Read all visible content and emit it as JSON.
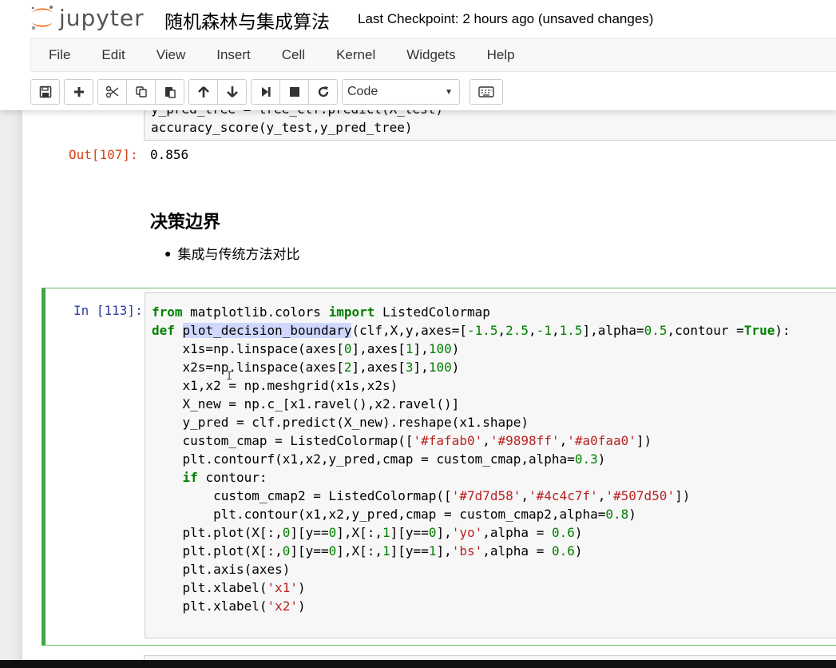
{
  "header": {
    "logo_text": "jupyter",
    "notebook_title": "随机森林与集成算法",
    "checkpoint": "Last Checkpoint: 2 hours ago (unsaved changes)"
  },
  "menu": [
    "File",
    "Edit",
    "View",
    "Insert",
    "Cell",
    "Kernel",
    "Widgets",
    "Help"
  ],
  "toolbar": {
    "cell_type": "Code",
    "icons": [
      "save-icon",
      "plus-icon",
      "cut-icon",
      "copy-icon",
      "paste-icon",
      "arrow-up-icon",
      "arrow-down-icon",
      "step-forward-icon",
      "stop-icon",
      "restart-icon",
      "keyboard-icon"
    ]
  },
  "cells": {
    "previous_input": {
      "line1": "y_pred_tree = tree_clf.predict(X_test)",
      "line2": "accuracy_score(y_test,y_pred_tree)"
    },
    "previous_output": {
      "prompt": "Out[107]:",
      "value": "0.856"
    },
    "markdown": {
      "heading": "决策边界",
      "bullet": "集成与传统方法对比"
    },
    "current": {
      "prompt": "In [113]:",
      "lines": [
        {
          "segments": [
            {
              "t": "from",
              "c": "kw"
            },
            {
              "t": " matplotlib.colors "
            },
            {
              "t": "import",
              "c": "kw"
            },
            {
              "t": " ListedColormap"
            }
          ]
        },
        {
          "segments": [
            {
              "t": "def",
              "c": "kw"
            },
            {
              "t": " "
            },
            {
              "t": "plot_decision_boundary",
              "c": "hl"
            },
            {
              "t": "(clf,X,y,axes=["
            },
            {
              "t": "-1.5",
              "c": "num"
            },
            {
              "t": ","
            },
            {
              "t": "2.5",
              "c": "num"
            },
            {
              "t": ","
            },
            {
              "t": "-1",
              "c": "num"
            },
            {
              "t": ","
            },
            {
              "t": "1.5",
              "c": "num"
            },
            {
              "t": "],alpha="
            },
            {
              "t": "0.5",
              "c": "num"
            },
            {
              "t": ",contour ="
            },
            {
              "t": "True",
              "c": "kw"
            },
            {
              "t": "):"
            }
          ]
        },
        {
          "segments": [
            {
              "t": "    x1s=np.linspace(axes["
            },
            {
              "t": "0",
              "c": "num"
            },
            {
              "t": "],axes["
            },
            {
              "t": "1",
              "c": "num"
            },
            {
              "t": "],"
            },
            {
              "t": "100",
              "c": "num"
            },
            {
              "t": ")"
            }
          ]
        },
        {
          "segments": [
            {
              "t": "    x2s=np.linspace(axes["
            },
            {
              "t": "2",
              "c": "num"
            },
            {
              "t": "],axes["
            },
            {
              "t": "3",
              "c": "num"
            },
            {
              "t": "],"
            },
            {
              "t": "100",
              "c": "num"
            },
            {
              "t": ")"
            }
          ]
        },
        {
          "segments": [
            {
              "t": "    x1,x2 = np.meshgrid(x1s,x2s)"
            }
          ]
        },
        {
          "segments": [
            {
              "t": "    X_new = np.c_[x1.ravel(),x2.ravel()]"
            }
          ]
        },
        {
          "segments": [
            {
              "t": "    y_pred = clf.predict(X_new).reshape(x1.shape)"
            }
          ]
        },
        {
          "segments": [
            {
              "t": "    custom_cmap = ListedColormap(["
            },
            {
              "t": "'#fafab0'",
              "c": "str"
            },
            {
              "t": ","
            },
            {
              "t": "'#9898ff'",
              "c": "str"
            },
            {
              "t": ","
            },
            {
              "t": "'#a0faa0'",
              "c": "str"
            },
            {
              "t": "])"
            }
          ]
        },
        {
          "segments": [
            {
              "t": "    plt.contourf(x1,x2,y_pred,cmap = custom_cmap,alpha="
            },
            {
              "t": "0.3",
              "c": "num"
            },
            {
              "t": ")"
            }
          ]
        },
        {
          "segments": [
            {
              "t": "    "
            },
            {
              "t": "if",
              "c": "kw"
            },
            {
              "t": " contour:"
            }
          ]
        },
        {
          "segments": [
            {
              "t": "        custom_cmap2 = ListedColormap(["
            },
            {
              "t": "'#7d7d58'",
              "c": "str"
            },
            {
              "t": ","
            },
            {
              "t": "'#4c4c7f'",
              "c": "str"
            },
            {
              "t": ","
            },
            {
              "t": "'#507d50'",
              "c": "str"
            },
            {
              "t": "])"
            }
          ]
        },
        {
          "segments": [
            {
              "t": "        plt.contour(x1,x2,y_pred,cmap = custom_cmap2,alpha="
            },
            {
              "t": "0.8",
              "c": "num"
            },
            {
              "t": ")"
            }
          ]
        },
        {
          "segments": [
            {
              "t": "    plt.plot(X[:,"
            },
            {
              "t": "0",
              "c": "num"
            },
            {
              "t": "][y=="
            },
            {
              "t": "0",
              "c": "num"
            },
            {
              "t": "],X[:,"
            },
            {
              "t": "1",
              "c": "num"
            },
            {
              "t": "][y=="
            },
            {
              "t": "0",
              "c": "num"
            },
            {
              "t": "],"
            },
            {
              "t": "'yo'",
              "c": "str"
            },
            {
              "t": ",alpha = "
            },
            {
              "t": "0.6",
              "c": "num"
            },
            {
              "t": ")"
            }
          ]
        },
        {
          "segments": [
            {
              "t": "    plt.plot(X[:,"
            },
            {
              "t": "0",
              "c": "num"
            },
            {
              "t": "][y=="
            },
            {
              "t": "0",
              "c": "num"
            },
            {
              "t": "],X[:,"
            },
            {
              "t": "1",
              "c": "num"
            },
            {
              "t": "][y=="
            },
            {
              "t": "1",
              "c": "num"
            },
            {
              "t": "],"
            },
            {
              "t": "'bs'",
              "c": "str"
            },
            {
              "t": ",alpha = "
            },
            {
              "t": "0.6",
              "c": "num"
            },
            {
              "t": ")"
            }
          ]
        },
        {
          "segments": [
            {
              "t": "    plt.axis(axes)"
            }
          ]
        },
        {
          "segments": [
            {
              "t": "    plt.xlabel("
            },
            {
              "t": "'x1'",
              "c": "str"
            },
            {
              "t": ")"
            }
          ]
        },
        {
          "segments": [
            {
              "t": "    plt.xlabel("
            },
            {
              "t": "'x2'",
              "c": "str"
            },
            {
              "t": ")"
            }
          ]
        }
      ]
    }
  }
}
